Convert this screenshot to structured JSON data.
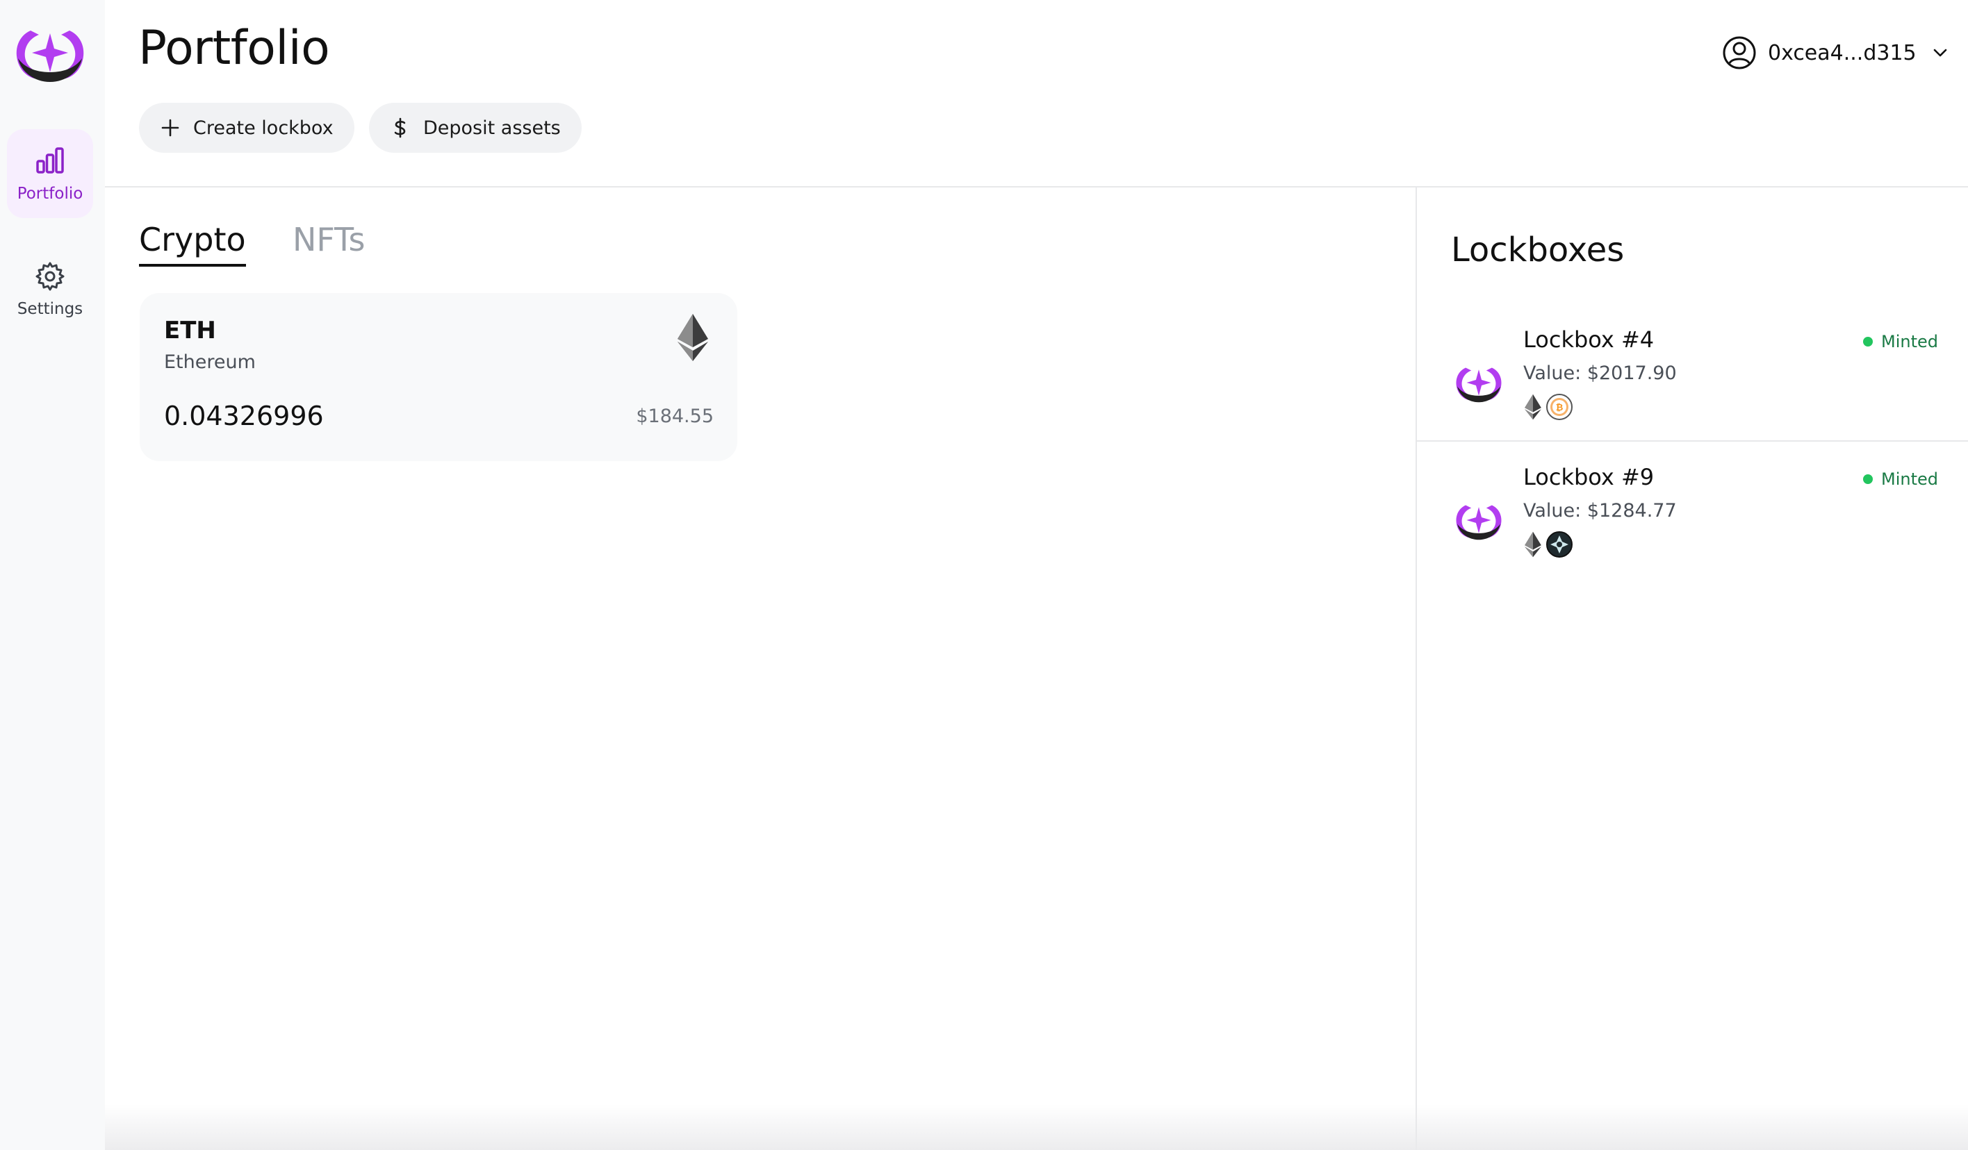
{
  "app": {
    "page_title": "Portfolio",
    "account_address": "0xcea4...d315"
  },
  "sidebar": {
    "items": [
      {
        "label": "Portfolio",
        "icon": "bar-chart-icon",
        "active": true
      },
      {
        "label": "Settings",
        "icon": "gear-icon",
        "active": false
      }
    ]
  },
  "actions": {
    "create_label": "Create lockbox",
    "deposit_label": "Deposit assets"
  },
  "tabs": [
    {
      "label": "Crypto",
      "active": true
    },
    {
      "label": "NFTs",
      "active": false
    }
  ],
  "assets": [
    {
      "symbol": "ETH",
      "name": "Ethereum",
      "amount": "0.04326996",
      "usd": "$184.55",
      "icon": "ethereum-icon"
    }
  ],
  "lockboxes": {
    "title": "Lockboxes",
    "items": [
      {
        "name": "Lockbox #4",
        "value": "Value: $2017.90",
        "status": "Minted",
        "assets": [
          "ethereum-icon",
          "bitcoin-icon"
        ]
      },
      {
        "name": "Lockbox #9",
        "value": "Value: $1284.77",
        "status": "Minted",
        "assets": [
          "ethereum-icon",
          "token-icon"
        ]
      }
    ]
  },
  "colors": {
    "accent": "#8b22c8",
    "brand_purple": "#b23df0",
    "status_green": "#22c55e",
    "sidebar_bg": "#f8f9fa"
  }
}
